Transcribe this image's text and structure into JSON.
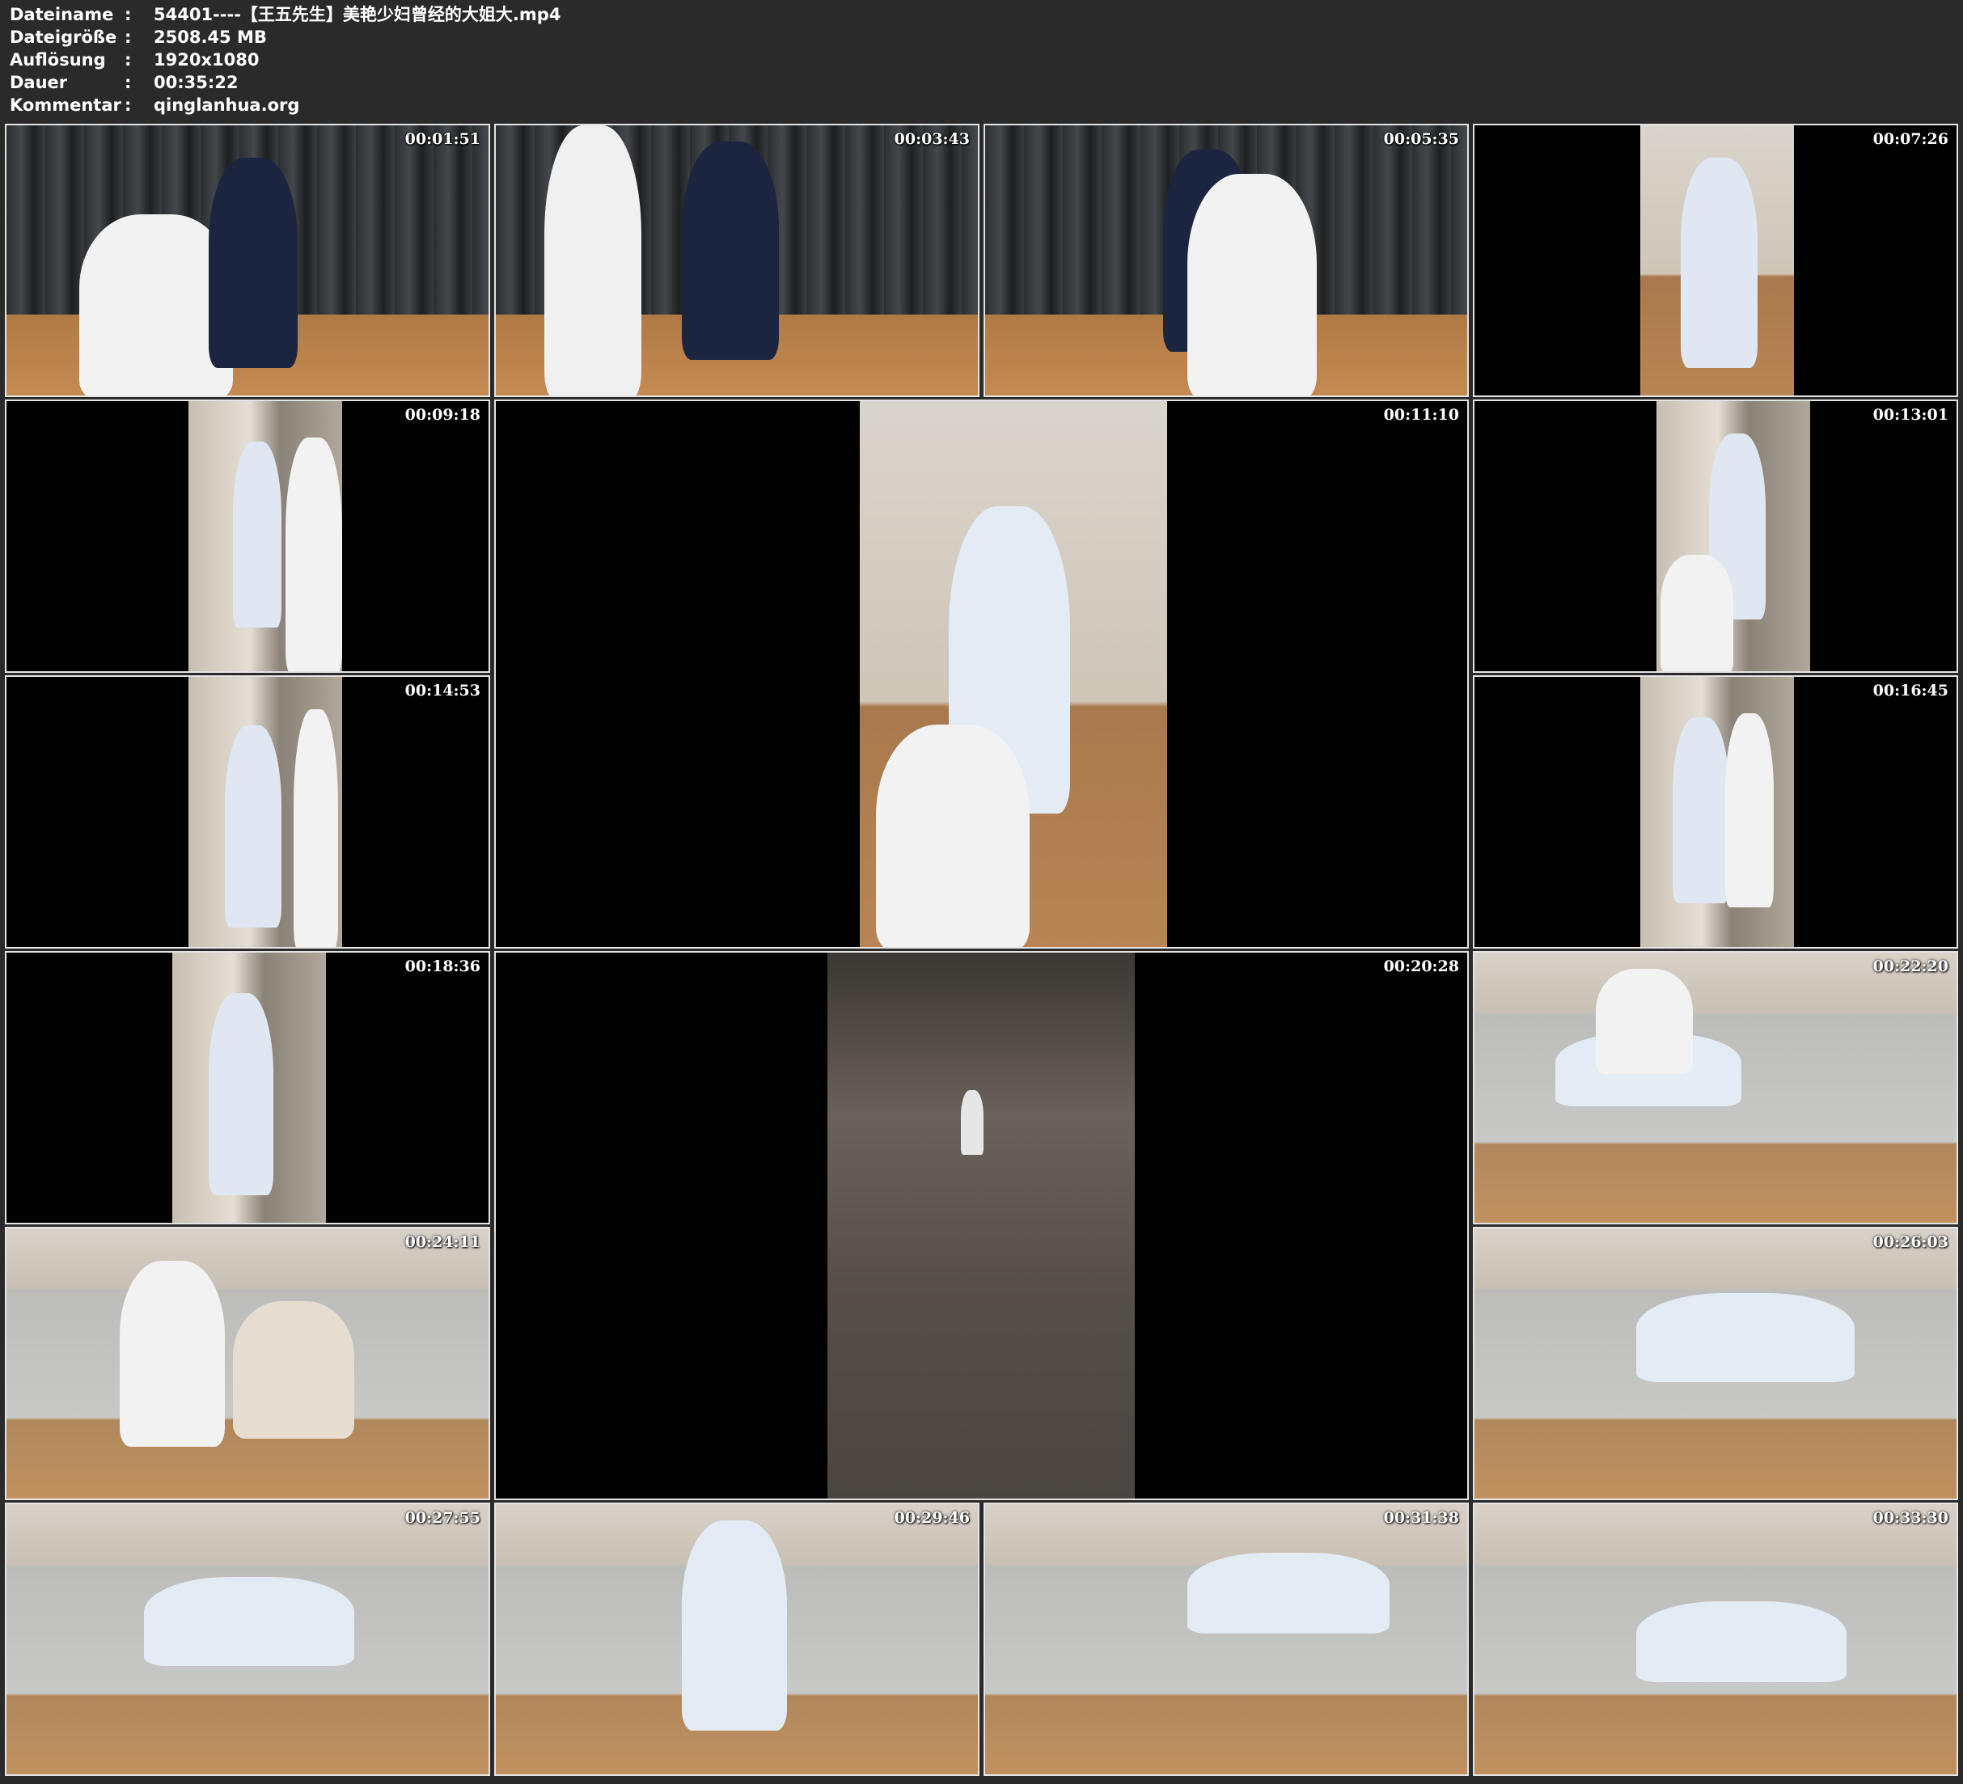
{
  "header": {
    "rows": [
      {
        "label": "Dateiname",
        "value": "54401----【王五先生】美艳少妇曾经的大姐大.mp4"
      },
      {
        "label": "Dateigröße",
        "value": "2508.45 MB"
      },
      {
        "label": "Auflösung",
        "value": "1920x1080"
      },
      {
        "label": "Dauer",
        "value": "00:35:22"
      },
      {
        "label": "Kommentar",
        "value": "qinglanhua.org"
      }
    ],
    "separator": ":"
  },
  "thumbnails": [
    {
      "timestamp": "00:01:51"
    },
    {
      "timestamp": "00:03:43"
    },
    {
      "timestamp": "00:05:35"
    },
    {
      "timestamp": "00:07:26"
    },
    {
      "timestamp": "00:09:18"
    },
    {
      "timestamp": "00:11:10"
    },
    {
      "timestamp": "00:13:01"
    },
    {
      "timestamp": "00:14:53"
    },
    {
      "timestamp": "00:16:45"
    },
    {
      "timestamp": "00:18:36"
    },
    {
      "timestamp": "00:20:28"
    },
    {
      "timestamp": "00:22:20"
    },
    {
      "timestamp": "00:24:11"
    },
    {
      "timestamp": "00:26:03"
    },
    {
      "timestamp": "00:27:55"
    },
    {
      "timestamp": "00:29:46"
    },
    {
      "timestamp": "00:31:38"
    },
    {
      "timestamp": "00:33:30"
    }
  ]
}
